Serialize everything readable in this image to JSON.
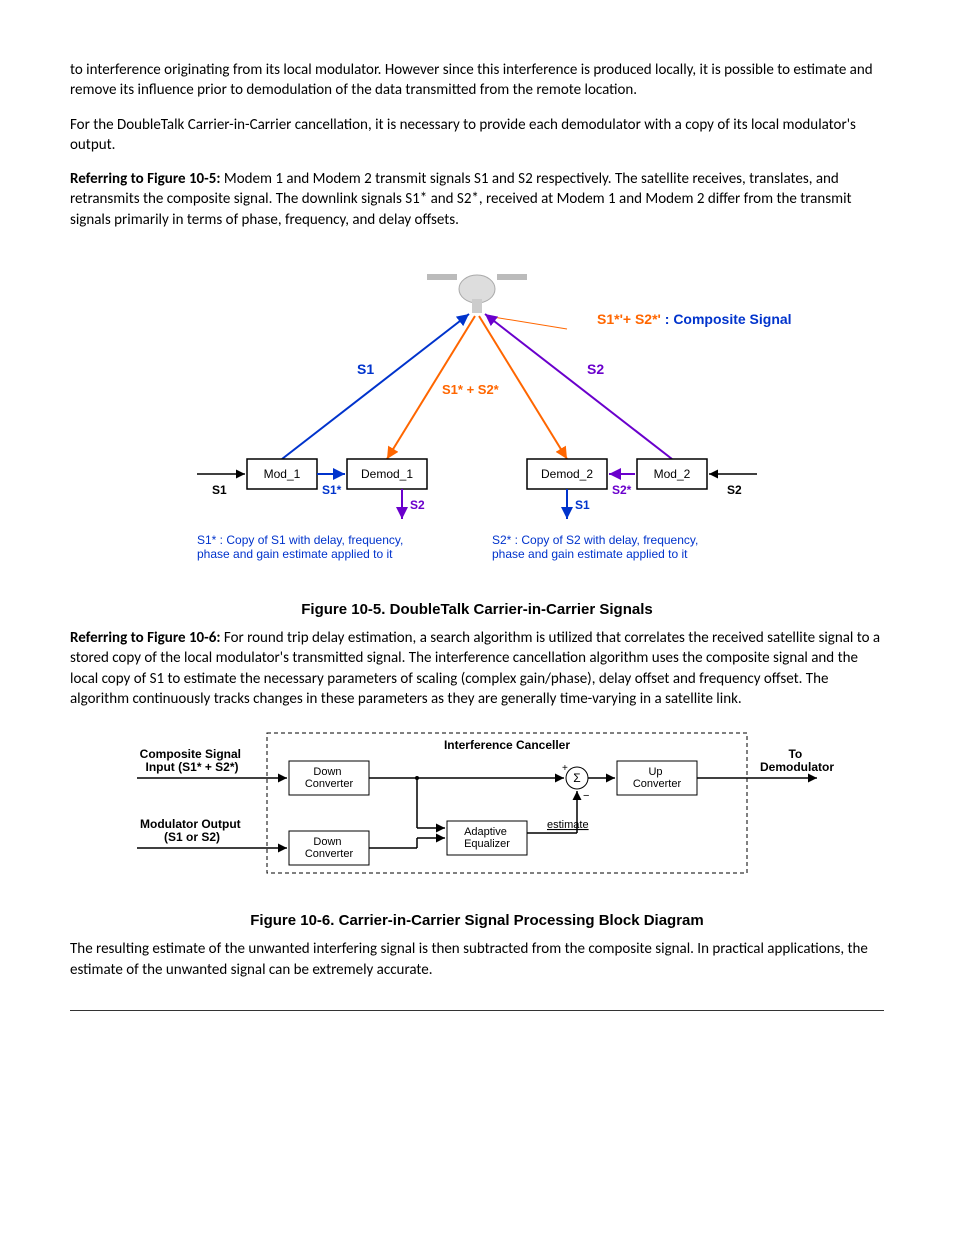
{
  "paragraphs": {
    "p1": "to interference originating from its local modulator. However since this interference is produced locally, it is possible to estimate and remove its influence prior to demodulation of the data transmitted from the remote location.",
    "p2": "For the DoubleTalk Carrier-in-Carrier cancellation, it is necessary to provide each demodulator with a copy of its local modulator's output.",
    "p3_lead": "Referring to Figure 10-5:",
    "p3_rest": " Modem 1 and Modem 2 transmit signals S1 and S2 respectively. The satellite receives, translates, and retransmits the composite signal. The downlink signals S1* and S2*, received at Modem 1 and Modem 2 differ from the transmit signals primarily in terms of phase, frequency, and delay offsets.",
    "p4_lead": "Referring to Figure 10-6:",
    "p4_rest": " For round trip delay estimation, a search algorithm is utilized that correlates the received satellite signal to a stored copy of the local modulator's transmitted signal. The interference cancellation algorithm uses the composite signal and the local copy of S1 to estimate the necessary parameters of scaling (complex gain/phase), delay offset and frequency offset. The algorithm continuously tracks changes in these parameters as they are generally time-varying in a satellite link.",
    "p5": "The resulting estimate of the unwanted interfering signal is then subtracted from the composite signal. In practical applications, the estimate of the unwanted signal can be extremely accurate."
  },
  "figure105": {
    "caption": "Figure 10-5. DoubleTalk Carrier-in-Carrier Signals",
    "composite_label_a": "S1*'+ S2*'",
    "composite_label_b": " : Composite Signal",
    "s1": "S1",
    "s2": "S2",
    "s1s2_down": "S1* + S2*",
    "mod1": "Mod_1",
    "demod1": "Demod_1",
    "demod2": "Demod_2",
    "mod2": "Mod_2",
    "s1_in": "S1",
    "s1_star": "S1*",
    "s2_out": "S2",
    "s2_star": "S2*",
    "s2_in": "S2",
    "s1_out": "S1",
    "note_left_a": "S1* : Copy of S1 with delay, frequency,",
    "note_left_b": "phase and gain estimate applied to it",
    "note_right_a": "S2* : Copy of S2 with delay, frequency,",
    "note_right_b": "phase and gain estimate applied to it"
  },
  "figure106": {
    "caption": "Figure 10-6. Carrier-in-Carrier Signal Processing Block Diagram",
    "composite_a": "Composite Signal",
    "composite_b": "Input (S1* + S2*)",
    "modout_a": "Modulator Output",
    "modout_b": "(S1 or S2)",
    "down_a": "Down",
    "down_b": "Converter",
    "up_a": "Up",
    "up_b": "Converter",
    "ae_a": "Adaptive",
    "ae_b": "Equalizer",
    "ic": "Interference Canceller",
    "estimate": "estimate",
    "sum": "Σ",
    "plus": "+",
    "minus": "−",
    "to_a": "To",
    "to_b": "Demodulator"
  }
}
